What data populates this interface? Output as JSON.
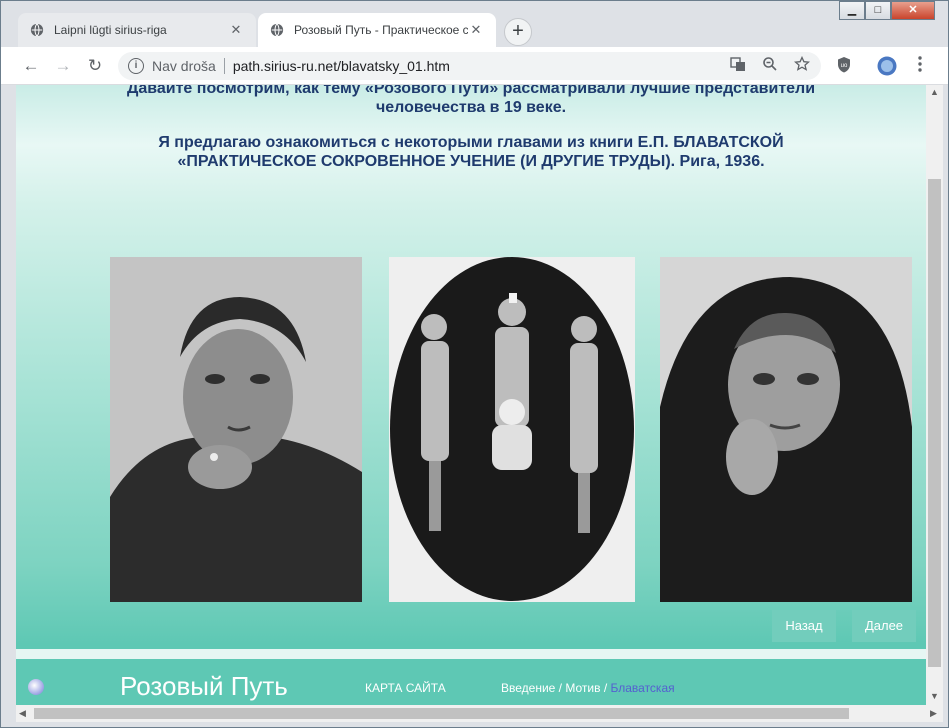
{
  "browser": {
    "tabs": [
      {
        "title": "Laipni lūgti sirius-riga",
        "close": "✕"
      },
      {
        "title": "Розовый Путь - Практическое с",
        "close": "✕"
      }
    ],
    "new_tab": "+",
    "window_controls": {
      "minimize": "▁",
      "maximize": "□",
      "close": "✕"
    },
    "nav": {
      "back": "←",
      "forward": "→",
      "reload": "↻"
    },
    "address": {
      "security": "Nav droša",
      "url": "path.sirius-ru.net/blavatsky_01.htm"
    },
    "toolbar_icons": [
      "translate-icon",
      "zoom-icon",
      "bookmark-star-icon",
      "ublock-icon",
      "profile-icon",
      "menu-icon"
    ]
  },
  "page": {
    "intro_line1": "Давайте посмотрим, как тему «Розового Пути» рассматривали лучшие представители",
    "intro_line2": "человечества в 19 веке.",
    "book_line1": "Я предлагаю ознакомиться с некоторыми главами из книги Е.П. БЛАВАТСКОЙ",
    "book_line2": "«ПРАКТИЧЕСКОЕ СОКРОВЕННОЕ УЧЕНИЕ (И ДРУГИЕ ТРУДЫ). Рига, 1936.",
    "back_label": "Назад",
    "next_label": "Далее"
  },
  "footer": {
    "brand": "Розовый Путь",
    "sitemap": "КАРТА САЙТА",
    "crumb_1": "Введение",
    "crumb_sep": " / ",
    "crumb_2": "Мотив",
    "crumb_current": "Блаватская"
  }
}
